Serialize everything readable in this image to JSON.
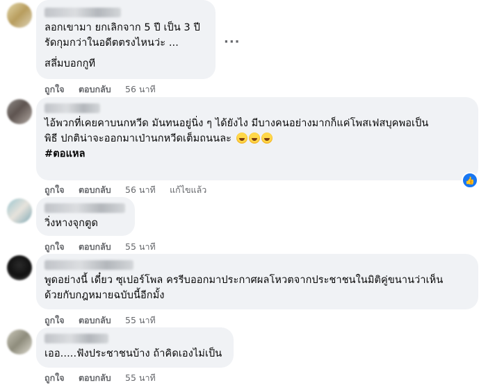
{
  "comments": [
    {
      "lines": [
        "ลอกเขามา ยกเลิกจาก 5 ปี เป็น 3 ปี",
        "รัดกุมกว่าในอดีตตรงไหนว่ะ ...",
        "สลึ่มบอกกูที"
      ],
      "like": "ถูกใจ",
      "reply": "ตอบกลับ",
      "time": "56 นาที",
      "edited": ""
    },
    {
      "lines": [
        "ไอ้พวกที่เคยคาบนกหวีด มันทนอยู่นิ่ง ๆ ได้ยังไง มีบางคนอย่างมากก็แค่โพสเฟสบุคพอเป็น",
        "พิธี ปกติน่าจะออกมาเป่านกหวีดเต็มถนนละ"
      ],
      "hashtag": "#ตอแหล",
      "like": "ถูกใจ",
      "reply": "ตอบกลับ",
      "time": "56 นาที",
      "edited": "แก้ไขแล้ว"
    },
    {
      "lines": [
        "วิ่งหางจุกตูด"
      ],
      "like": "ถูกใจ",
      "reply": "ตอบกลับ",
      "time": "55 นาที",
      "edited": ""
    },
    {
      "lines": [
        "พูดอย่างนี้ เดี๋ยว ซุเปอร์โพล ครรีบออกมาประกาศผลโหวตจากประชาชนในมิติคู่ขนานว่าเห็น",
        "ด้วยกับกฎหมายฉบับนี้อีกมั้ง"
      ],
      "like": "ถูกใจ",
      "reply": "ตอบกลับ",
      "time": "55 นาที",
      "edited": ""
    },
    {
      "lines": [
        "เออ.....ฟังประชาชนบ้าง ถ้าคิดเองไม่เป็น"
      ],
      "like": "ถูกใจ",
      "reply": "ตอบกลับ",
      "time": "55 นาที",
      "edited": ""
    }
  ],
  "icons": {
    "more": "more-options-icon",
    "emoji": "rolling-laughing-emoji-icon",
    "like_badge": "like-reaction-icon"
  },
  "colors": {
    "bubble": "#f0f2f5",
    "meta_text": "#65676b",
    "like_blue": "#1877f2"
  }
}
